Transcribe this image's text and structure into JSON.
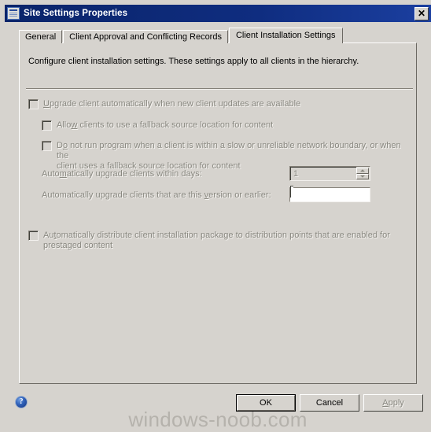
{
  "window": {
    "title": "Site Settings Properties",
    "icon": "form-window-icon",
    "close_label": "✕",
    "colors": {
      "titlebar": "#0a246a",
      "face": "#d6d3ce",
      "disabled_text": "#898880",
      "text": "#000000"
    }
  },
  "tabs": [
    {
      "label": "General",
      "active": false
    },
    {
      "label": "Client Approval and Conflicting Records",
      "active": false
    },
    {
      "label": "Client Installation Settings",
      "active": true
    }
  ],
  "panel": {
    "description": "Configure client installation settings.  These settings apply to all clients in the hierarchy.",
    "checkboxes": [
      {
        "id": "upgrade-client-automatically",
        "pre": "",
        "accel": "U",
        "post": "pgrade client automatically when new client updates are available",
        "line2": "",
        "checked": false,
        "enabled": false
      },
      {
        "id": "allow-fallback-source-location",
        "pre": "Allo",
        "accel": "w",
        "post": " clients to use a fallback source location for content",
        "line2": "",
        "checked": false,
        "enabled": false
      },
      {
        "id": "do-not-run-program-slow-network",
        "pre": "D",
        "accel": "o",
        "post": " not run program when a client is within a slow or unreliable network boundary, or when the",
        "line2": "client uses a fallback source location for content",
        "checked": false,
        "enabled": false
      },
      {
        "id": "auto-distribute-installation-package",
        "pre": "Au",
        "accel": "t",
        "post": "omatically distribute client installation package to distribution points that are enabled for",
        "line2": "prestaged content",
        "checked": false,
        "enabled": false
      }
    ],
    "fields": [
      {
        "id": "upgrade-within-days",
        "pre": "Auto",
        "accel": "m",
        "post": "atically upgrade clients within days:",
        "value": "1",
        "control": "spinner",
        "enabled": false
      },
      {
        "id": "upgrade-version-or-earlier",
        "pre": "Automatically upgrade clients that are this ",
        "accel": "v",
        "post": "ersion or earlier:",
        "value": "",
        "control": "textbox",
        "enabled": false
      }
    ]
  },
  "footer": {
    "help_icon": "help-question-icon",
    "buttons": [
      {
        "id": "ok",
        "label": "OK",
        "default": true,
        "enabled": true
      },
      {
        "id": "cancel",
        "label": "Cancel",
        "default": false,
        "enabled": true
      },
      {
        "id": "apply",
        "pre": "",
        "accel": "A",
        "post": "pply",
        "default": false,
        "enabled": false
      }
    ]
  },
  "watermark": "windows-noob.com"
}
